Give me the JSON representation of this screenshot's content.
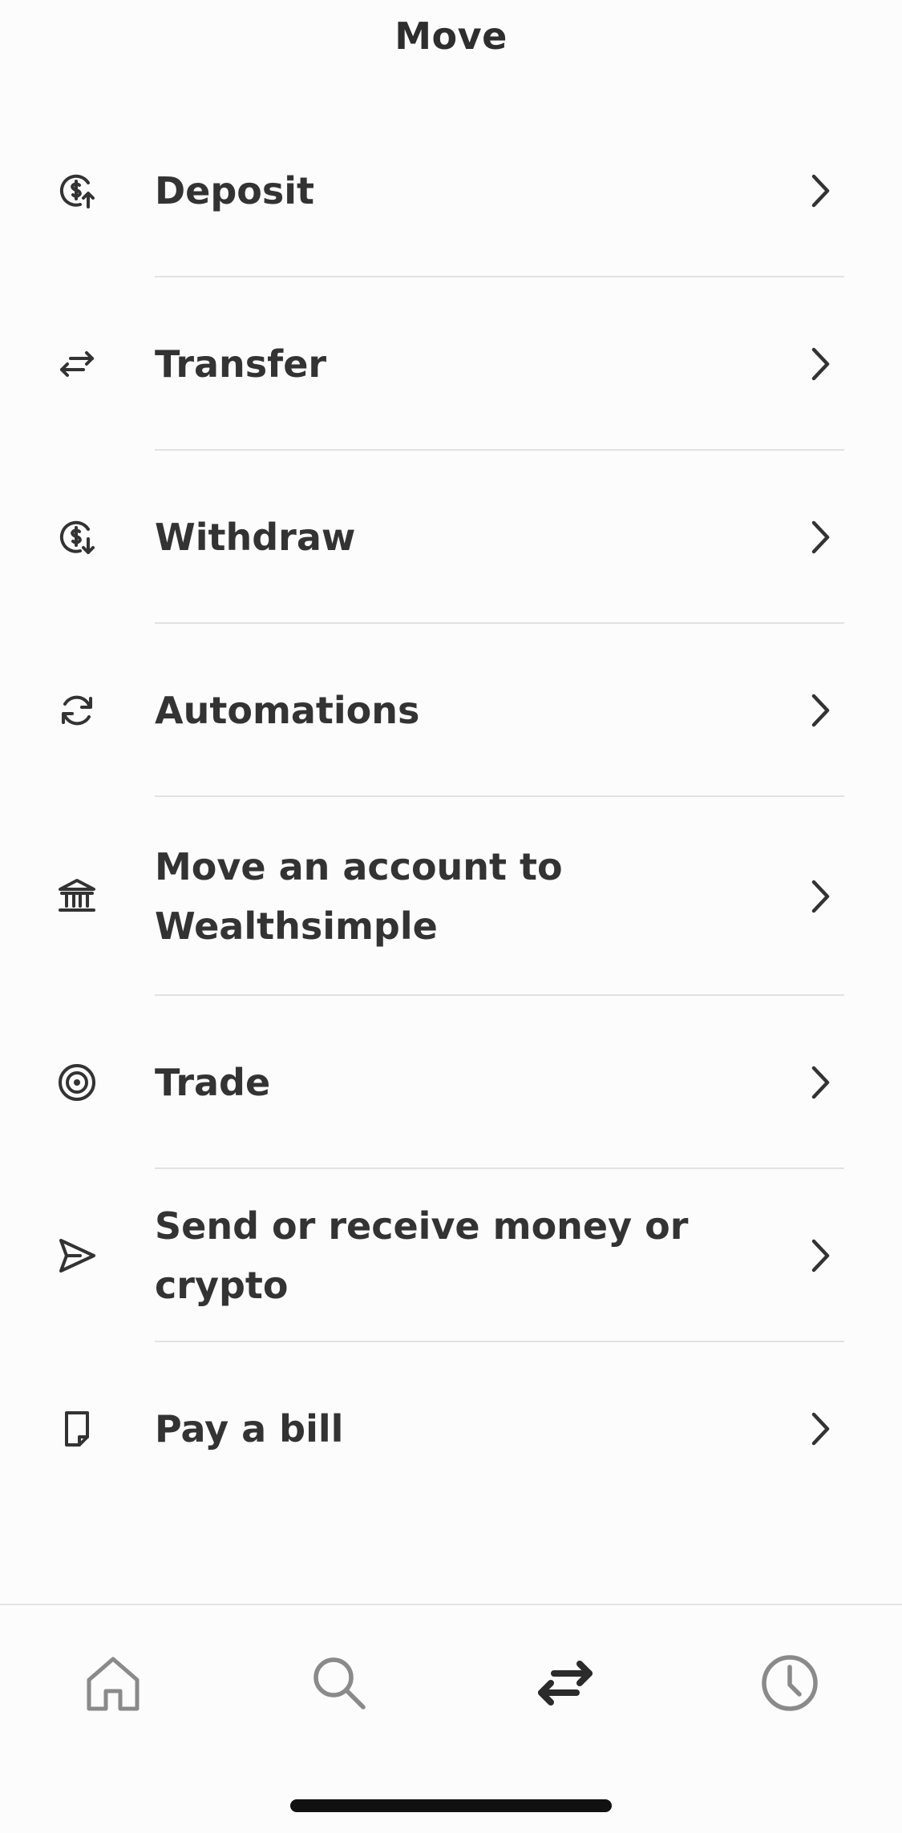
{
  "header": {
    "title": "Move"
  },
  "menu": {
    "items": [
      {
        "label": "Deposit",
        "icon": "dollar-up-icon"
      },
      {
        "label": "Transfer",
        "icon": "transfer-arrows-icon"
      },
      {
        "label": "Withdraw",
        "icon": "dollar-down-icon"
      },
      {
        "label": "Automations",
        "icon": "refresh-icon"
      },
      {
        "label": "Move an account to Wealthsimple",
        "icon": "bank-icon"
      },
      {
        "label": "Trade",
        "icon": "target-icon"
      },
      {
        "label": "Send or receive money or crypto",
        "icon": "send-icon"
      },
      {
        "label": "Pay a bill",
        "icon": "bill-icon"
      }
    ]
  },
  "tab_bar": {
    "tabs": [
      {
        "name": "home",
        "icon": "home-icon",
        "active": false
      },
      {
        "name": "search",
        "icon": "search-icon",
        "active": false
      },
      {
        "name": "move",
        "icon": "transfer-arrows-icon",
        "active": true
      },
      {
        "name": "activity",
        "icon": "clock-icon",
        "active": false
      }
    ]
  },
  "colors": {
    "text": "#333333",
    "divider": "#e2e2e2",
    "inactive_icon": "#8a8a8a",
    "active_icon": "#2b2b2b",
    "background": "#fcfcfc"
  }
}
